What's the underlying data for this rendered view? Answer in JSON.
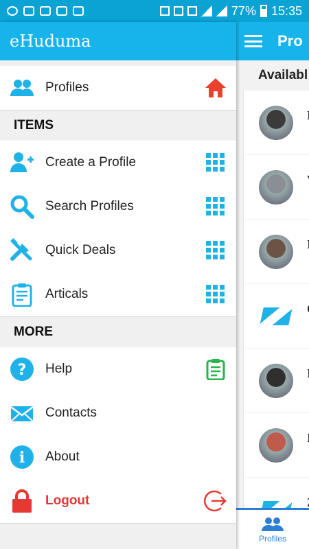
{
  "status_bar": {
    "battery": "77%",
    "time": "15:35"
  },
  "drawer": {
    "title": "eHuduma",
    "top_item": {
      "label": "Profiles",
      "lead_icon": "users-icon",
      "trail_icon": "home-icon"
    },
    "sections": [
      {
        "title": "ITEMS",
        "items": [
          {
            "label": "Create a Profile",
            "lead_icon": "add-user-icon",
            "trail_icon": "grid-icon"
          },
          {
            "label": "Search Profiles",
            "lead_icon": "search-icon",
            "trail_icon": "grid-icon"
          },
          {
            "label": "Quick Deals",
            "lead_icon": "tools-icon",
            "trail_icon": "grid-icon"
          },
          {
            "label": "Articals",
            "lead_icon": "clipboard-icon",
            "trail_icon": "grid-icon"
          }
        ]
      },
      {
        "title": "MORE",
        "items": [
          {
            "label": "Help",
            "lead_icon": "help-icon",
            "trail_icon": "clipboard-green-icon"
          },
          {
            "label": "Contacts",
            "lead_icon": "mail-icon"
          },
          {
            "label": "About",
            "lead_icon": "info-icon"
          },
          {
            "label": "Logout",
            "lead_icon": "lock-icon",
            "trail_icon": "logout-icon"
          }
        ]
      }
    ]
  },
  "main": {
    "title": "Pro",
    "list_header": "Availabl",
    "cards": [
      {
        "initial": "I",
        "avatar": "photo"
      },
      {
        "initial": "V",
        "avatar": "photo"
      },
      {
        "initial": "I",
        "avatar": "photo"
      },
      {
        "initial": "C",
        "avatar": "logo"
      },
      {
        "initial": "I",
        "avatar": "photo"
      },
      {
        "initial": "I",
        "avatar": "photo"
      },
      {
        "initial": "Z",
        "avatar": "logo"
      }
    ],
    "bottom_nav": {
      "label": "Profiles"
    }
  },
  "colors": {
    "primary": "#16b4ea",
    "accent_blue": "#1fb2e8",
    "logout_red": "#e53935",
    "help_green": "#2bb24c"
  }
}
